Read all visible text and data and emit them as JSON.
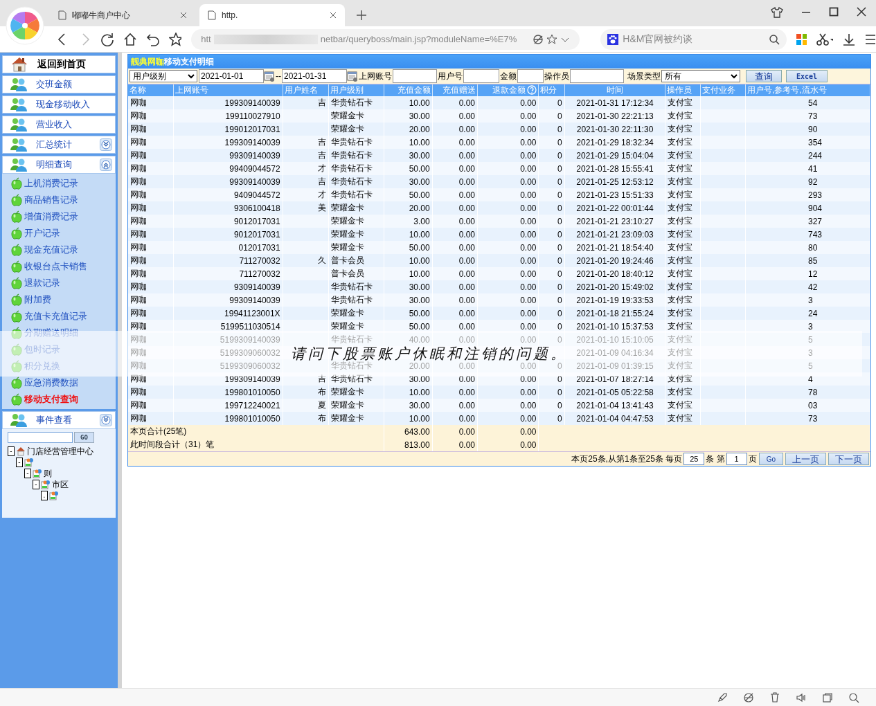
{
  "browser": {
    "tabs": [
      {
        "title": "嘟嘟牛商户中心",
        "selected": false
      },
      {
        "title": "http.",
        "selected": true
      }
    ],
    "address": "htt",
    "address_tail": "netbar/queryboss/main.jsp?moduleName=%E7%",
    "search": "H&M官网被约谈"
  },
  "sidebar": {
    "home": "返回到首页",
    "sections": [
      {
        "label": "交班金额",
        "kind": "plain"
      },
      {
        "label": "现金移动收入",
        "kind": "plain"
      },
      {
        "label": "营业收入",
        "kind": "plain"
      },
      {
        "label": "汇总统计",
        "kind": "group",
        "expanded": false
      },
      {
        "label": "明细查询",
        "kind": "group",
        "expanded": true,
        "items": [
          {
            "label": "上机消费记录",
            "selected": false
          },
          {
            "label": "商品销售记录",
            "selected": false
          },
          {
            "label": "增值消费记录",
            "selected": false
          },
          {
            "label": "开户记录",
            "selected": false
          },
          {
            "label": "现金充值记录",
            "selected": false
          },
          {
            "label": "收银台点卡销售",
            "selected": false
          },
          {
            "label": "退款记录",
            "selected": false
          },
          {
            "label": "附加费",
            "selected": false
          },
          {
            "label": "充值卡充值记录",
            "selected": false
          },
          {
            "label": "分期赠送明细",
            "selected": false
          },
          {
            "label": "包时记录",
            "selected": false
          },
          {
            "label": "积分兑换",
            "selected": false
          },
          {
            "label": "应急消费数据",
            "selected": false
          },
          {
            "label": "移动支付查询",
            "selected": true
          }
        ]
      },
      {
        "label": "事件查看",
        "kind": "group",
        "expanded": false
      }
    ],
    "tree_search_button": "GO",
    "tree": [
      {
        "toggle": "-",
        "label": "门店经营管理中心",
        "children": [
          {
            "toggle": "-",
            "children": [
              {
                "toggle": "-",
                "label": "则",
                "children": [
                  {
                    "toggle": "-",
                    "label": "市区",
                    "children": [
                      {
                        "toggle": "."
                      }
                    ]
                  }
                ]
              }
            ]
          }
        ]
      }
    ]
  },
  "panel": {
    "store": "靓典网咖",
    "title": "移动支付明细",
    "filters": {
      "level_select": "用户级别",
      "date_from": "2021-01-01",
      "date_sep": "--",
      "date_to": "2021-01-31",
      "account_label": "上网账号",
      "user_label": "用户号",
      "amount_label": "金额",
      "operator_label": "操作员",
      "scene_label": "场景类型",
      "scene_select": "所有",
      "query_button": "查询",
      "excel_button": "Excel"
    },
    "columns": [
      "名称",
      "上网账号",
      "用户姓名",
      "用户级别",
      "充值金额",
      "充值赠送",
      "退款金额",
      "积分",
      "时间",
      "操作员",
      "支付业务",
      "用户号,参考号,流水号"
    ],
    "rows": [
      {
        "store": "网咖",
        "account": "199309140039",
        "name": "吉",
        "level": "华贵钻石卡",
        "amount": "10.00",
        "gift": "0.00",
        "refund": "0.00",
        "points": "0",
        "time": "2021-01-31 17:12:34",
        "operator": "支付宝",
        "ref": "54"
      },
      {
        "store": "网咖",
        "account": "199110027910",
        "level": "荣耀金卡",
        "amount": "30.00",
        "gift": "0.00",
        "refund": "0.00",
        "points": "0",
        "time": "2021-01-30 22:21:13",
        "operator": "支付宝",
        "ref": "73"
      },
      {
        "store": "网咖",
        "account": "199012017031",
        "level": "荣耀金卡",
        "amount": "20.00",
        "gift": "0.00",
        "refund": "0.00",
        "points": "0",
        "time": "2021-01-30 22:11:30",
        "operator": "支付宝",
        "ref": "90"
      },
      {
        "store": "网咖",
        "account": "199309140039",
        "name": "吉",
        "level": "华贵钻石卡",
        "amount": "10.00",
        "gift": "0.00",
        "refund": "0.00",
        "points": "0",
        "time": "2021-01-29 18:32:34",
        "operator": "支付宝",
        "ref": "354"
      },
      {
        "store": "网咖",
        "account": "99309140039",
        "name": "吉",
        "level": "华贵钻石卡",
        "amount": "30.00",
        "gift": "0.00",
        "refund": "0.00",
        "points": "0",
        "time": "2021-01-29 15:04:04",
        "operator": "支付宝",
        "ref": "244"
      },
      {
        "store": "网咖",
        "account": "99409044572",
        "name": "才",
        "level": "华贵钻石卡",
        "amount": "50.00",
        "gift": "0.00",
        "refund": "0.00",
        "points": "0",
        "time": "2021-01-28 15:55:41",
        "operator": "支付宝",
        "ref": "41"
      },
      {
        "store": "网咖",
        "account": "99309140039",
        "name": "吉",
        "level": "华贵钻石卡",
        "amount": "30.00",
        "gift": "0.00",
        "refund": "0.00",
        "points": "0",
        "time": "2021-01-25 12:53:12",
        "operator": "支付宝",
        "ref": "92"
      },
      {
        "store": "网咖",
        "account": "9409044572",
        "name": "才",
        "level": "华贵钻石卡",
        "amount": "50.00",
        "gift": "0.00",
        "refund": "0.00",
        "points": "0",
        "time": "2021-01-23 15:51:33",
        "operator": "支付宝",
        "ref": "293"
      },
      {
        "store": "网咖",
        "account": "9306100418",
        "name": "美",
        "level": "荣耀金卡",
        "amount": "20.00",
        "gift": "0.00",
        "refund": "0.00",
        "points": "0",
        "time": "2021-01-22 00:01:44",
        "operator": "支付宝",
        "ref": "904"
      },
      {
        "store": "网咖",
        "account": "9012017031",
        "level": "荣耀金卡",
        "amount": "3.00",
        "gift": "0.00",
        "refund": "0.00",
        "points": "0",
        "time": "2021-01-21 23:10:27",
        "operator": "支付宝",
        "ref": "327"
      },
      {
        "store": "网咖",
        "account": "9012017031",
        "level": "荣耀金卡",
        "amount": "10.00",
        "gift": "0.00",
        "refund": "0.00",
        "points": "0",
        "time": "2021-01-21 23:09:03",
        "operator": "支付宝",
        "ref": "743"
      },
      {
        "store": "网咖",
        "account": "012017031",
        "level": "荣耀金卡",
        "amount": "50.00",
        "gift": "0.00",
        "refund": "0.00",
        "points": "0",
        "time": "2021-01-21 18:54:40",
        "operator": "支付宝",
        "ref": "80"
      },
      {
        "store": "网咖",
        "account": "711270032",
        "name": "久",
        "level": "普卡会员",
        "amount": "10.00",
        "gift": "0.00",
        "refund": "0.00",
        "points": "0",
        "time": "2021-01-20 19:24:46",
        "operator": "支付宝",
        "ref": "85"
      },
      {
        "store": "网咖",
        "account": "711270032",
        "level": "普卡会员",
        "amount": "10.00",
        "gift": "0.00",
        "refund": "0.00",
        "points": "0",
        "time": "2021-01-20 18:40:12",
        "operator": "支付宝",
        "ref": "12"
      },
      {
        "store": "网咖",
        "account": "9309140039",
        "level": "华贵钻石卡",
        "amount": "30.00",
        "gift": "0.00",
        "refund": "0.00",
        "points": "0",
        "time": "2021-01-20 15:49:02",
        "operator": "支付宝",
        "ref": "42"
      },
      {
        "store": "网咖",
        "account": "99309140039",
        "level": "华贵钻石卡",
        "amount": "30.00",
        "gift": "0.00",
        "refund": "0.00",
        "points": "0",
        "time": "2021-01-19 19:33:53",
        "operator": "支付宝",
        "ref": "3"
      },
      {
        "store": "网咖",
        "account": "19941123001X",
        "level": "荣耀金卡",
        "amount": "50.00",
        "gift": "0.00",
        "refund": "0.00",
        "points": "0",
        "time": "2021-01-18 21:55:24",
        "operator": "支付宝",
        "ref": "24"
      },
      {
        "store": "网咖",
        "account": "5199511030514",
        "level": "荣耀金卡",
        "amount": "50.00",
        "gift": "0.00",
        "refund": "0.00",
        "points": "0",
        "time": "2021-01-10 15:37:53",
        "operator": "支付宝",
        "ref": "3"
      },
      {
        "store": "网咖",
        "account": "5199309140039",
        "level": "华贵钻石卡",
        "amount": "40.00",
        "gift": "0.00",
        "refund": "0.00",
        "points": "0",
        "time": "2021-01-10 15:10:05",
        "operator": "支付宝",
        "ref": "5"
      },
      {
        "store": "网咖",
        "account": "5199309060032",
        "time": "2021-01-09 04:16:34",
        "operator": "支付宝",
        "ref": "3"
      },
      {
        "store": "网咖",
        "account": "5199309060032",
        "level": "华贵钻石卡",
        "amount": "20.00",
        "gift": "0.00",
        "refund": "0.00",
        "points": "0",
        "time": "2021-01-09 01:39:15",
        "operator": "支付宝",
        "ref": "5"
      },
      {
        "store": "网咖",
        "account": "199309140039",
        "name": "吉",
        "level": "华贵钻石卡",
        "amount": "30.00",
        "gift": "0.00",
        "refund": "0.00",
        "points": "0",
        "time": "2021-01-07 18:27:14",
        "operator": "支付宝",
        "ref": "4"
      },
      {
        "store": "网咖",
        "account": "199801010050",
        "name": "布",
        "level": "荣耀金卡",
        "amount": "10.00",
        "gift": "0.00",
        "refund": "0.00",
        "points": "0",
        "time": "2021-01-05 05:22:58",
        "operator": "支付宝",
        "ref": "78"
      },
      {
        "store": "网咖",
        "account": "199712240021",
        "name": "夏",
        "level": "荣耀金卡",
        "amount": "30.00",
        "gift": "0.00",
        "refund": "0.00",
        "points": "0",
        "time": "2021-01-04 13:41:43",
        "operator": "支付宝",
        "ref": "03"
      },
      {
        "store": "网咖",
        "account": "199801010050",
        "name": "布",
        "level": "荣耀金卡",
        "amount": "10.00",
        "gift": "0.00",
        "refund": "0.00",
        "points": "0",
        "time": "2021-01-04 04:47:53",
        "operator": "支付宝",
        "ref": "73"
      }
    ],
    "totals": [
      {
        "label": "本页合计(25笔)",
        "amount": "643.00",
        "gift": "0.00",
        "refund": "0.00"
      },
      {
        "label": "此时间段合计（31）笔",
        "amount": "813.00",
        "gift": "0.00",
        "refund": "0.00"
      }
    ],
    "pager": {
      "summary": "本页25条,从第1条至25条 每页",
      "page_size": "25",
      "unit": "条 第",
      "page": "1",
      "page_unit": "页",
      "go": "Go",
      "prev": "上一页",
      "next": "下一页"
    }
  },
  "overlay": {
    "caption": "请问下股票账户休眠和注销的问题。"
  }
}
